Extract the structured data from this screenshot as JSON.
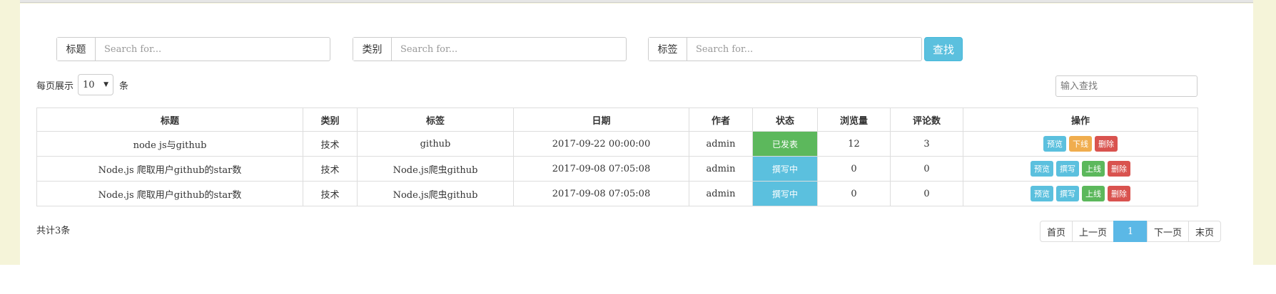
{
  "search": {
    "title": {
      "label": "标题",
      "placeholder": "Search for..."
    },
    "category": {
      "label": "类别",
      "placeholder": "Search for..."
    },
    "tag": {
      "label": "标签",
      "placeholder": "Search for..."
    },
    "button_label": "查找"
  },
  "perpage": {
    "prefix": "每页展示",
    "value": "10",
    "suffix": "条"
  },
  "filter": {
    "placeholder": "输入查找"
  },
  "table": {
    "headers": [
      "标题",
      "类别",
      "标签",
      "日期",
      "作者",
      "状态",
      "浏览量",
      "评论数",
      "操作"
    ],
    "rows": [
      {
        "title": "node js与github",
        "category": "技术",
        "tag": "github",
        "date": "2017-09-22  00:00:00",
        "author": "admin",
        "status": "已发表",
        "status_color": "#5cb85c",
        "views": "12",
        "comments": "3",
        "actions": [
          {
            "label": "预览",
            "kind": "info"
          },
          {
            "label": "下线",
            "kind": "warning"
          },
          {
            "label": "删除",
            "kind": "danger"
          }
        ]
      },
      {
        "title": "Node.js  爬取用户github的star数",
        "category": "技术",
        "tag": "Node.js爬虫github",
        "date": "2017-09-08  07:05:08",
        "author": "admin",
        "status": "撰写中",
        "status_color": "#5bc0de",
        "views": "0",
        "comments": "0",
        "actions": [
          {
            "label": "预览",
            "kind": "info"
          },
          {
            "label": "撰写",
            "kind": "info"
          },
          {
            "label": "上线",
            "kind": "success"
          },
          {
            "label": "删除",
            "kind": "danger"
          }
        ]
      },
      {
        "title": "Node.js  爬取用户github的star数",
        "category": "技术",
        "tag": "Node.js爬虫github",
        "date": "2017-09-08  07:05:08",
        "author": "admin",
        "status": "撰写中",
        "status_color": "#5bc0de",
        "views": "0",
        "comments": "0",
        "actions": [
          {
            "label": "预览",
            "kind": "info"
          },
          {
            "label": "撰写",
            "kind": "info"
          },
          {
            "label": "上线",
            "kind": "success"
          },
          {
            "label": "删除",
            "kind": "danger"
          }
        ]
      }
    ]
  },
  "footer": {
    "total": "共计3条",
    "pager": [
      "首页",
      "上一页",
      "1",
      "下一页",
      "末页"
    ],
    "active_page": "1"
  },
  "colors": {
    "accent": "#5bc0de",
    "page_bg": "#f5f4d9"
  }
}
